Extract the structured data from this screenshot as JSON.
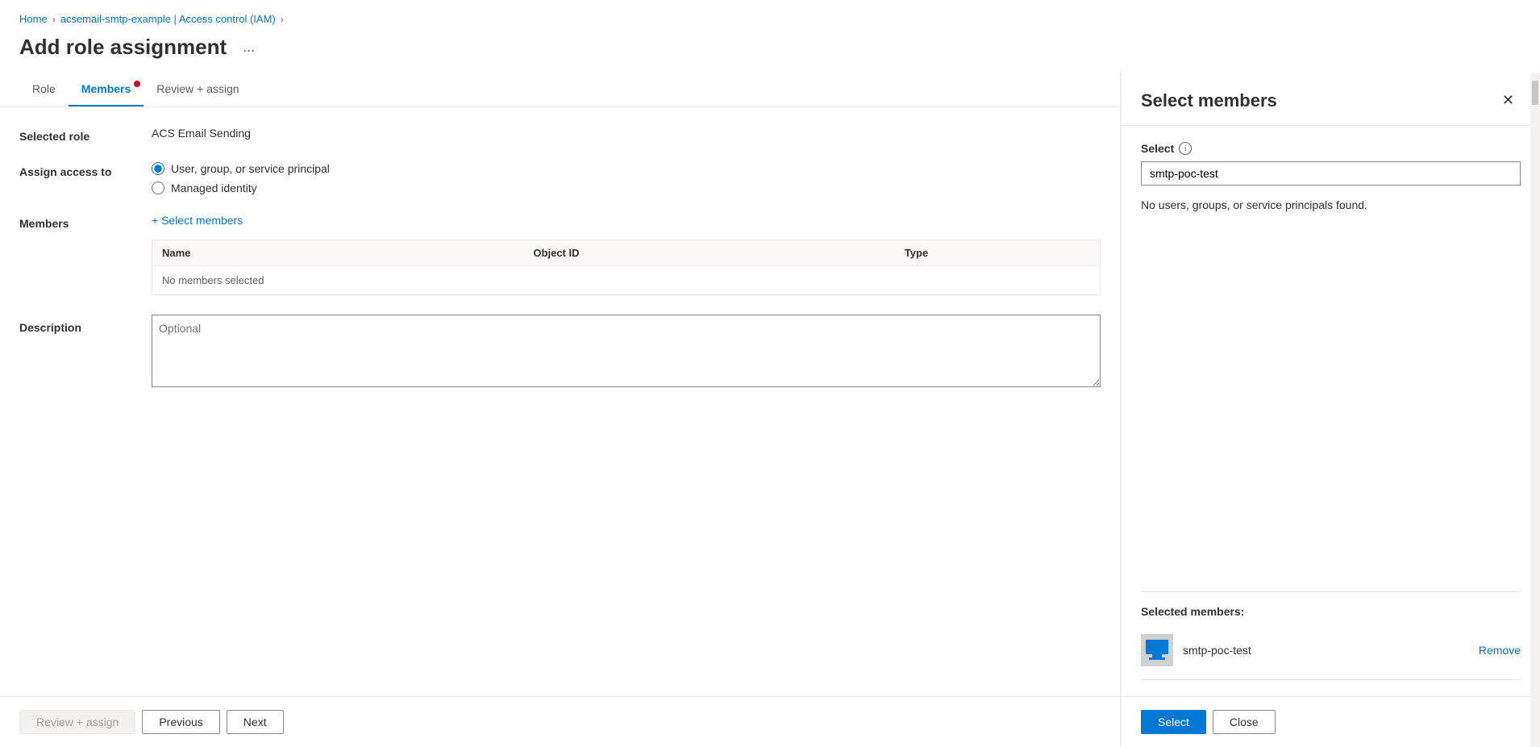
{
  "breadcrumb": {
    "home": "Home",
    "resource": "acsemail-smtp-example | Access control (IAM)",
    "sep1": ">",
    "sep2": ">"
  },
  "page": {
    "title": "Add role assignment",
    "more_options": "..."
  },
  "tabs": [
    {
      "id": "role",
      "label": "Role",
      "active": false,
      "has_dot": false
    },
    {
      "id": "members",
      "label": "Members",
      "active": true,
      "has_dot": true
    },
    {
      "id": "review",
      "label": "Review + assign",
      "active": false,
      "has_dot": false
    }
  ],
  "form": {
    "selected_role_label": "Selected role",
    "selected_role_value": "ACS Email Sending",
    "assign_access_label": "Assign access to",
    "radio_option1": "User, group, or service principal",
    "radio_option2": "Managed identity",
    "members_label": "Members",
    "select_members_link": "+ Select members",
    "table": {
      "col_name": "Name",
      "col_objectid": "Object ID",
      "col_type": "Type",
      "empty_message": "No members selected"
    },
    "description_label": "Description",
    "description_placeholder": "Optional"
  },
  "bottom_bar": {
    "review_assign": "Review + assign",
    "previous": "Previous",
    "next": "Next"
  },
  "right_panel": {
    "title": "Select members",
    "select_label": "Select",
    "search_value": "smtp-poc-test",
    "no_results_message": "No users, groups, or service principals found.",
    "selected_members_label": "Selected members:",
    "selected_member_name": "smtp-poc-test",
    "remove_label": "Remove",
    "select_button": "Select",
    "close_button": "Close"
  }
}
